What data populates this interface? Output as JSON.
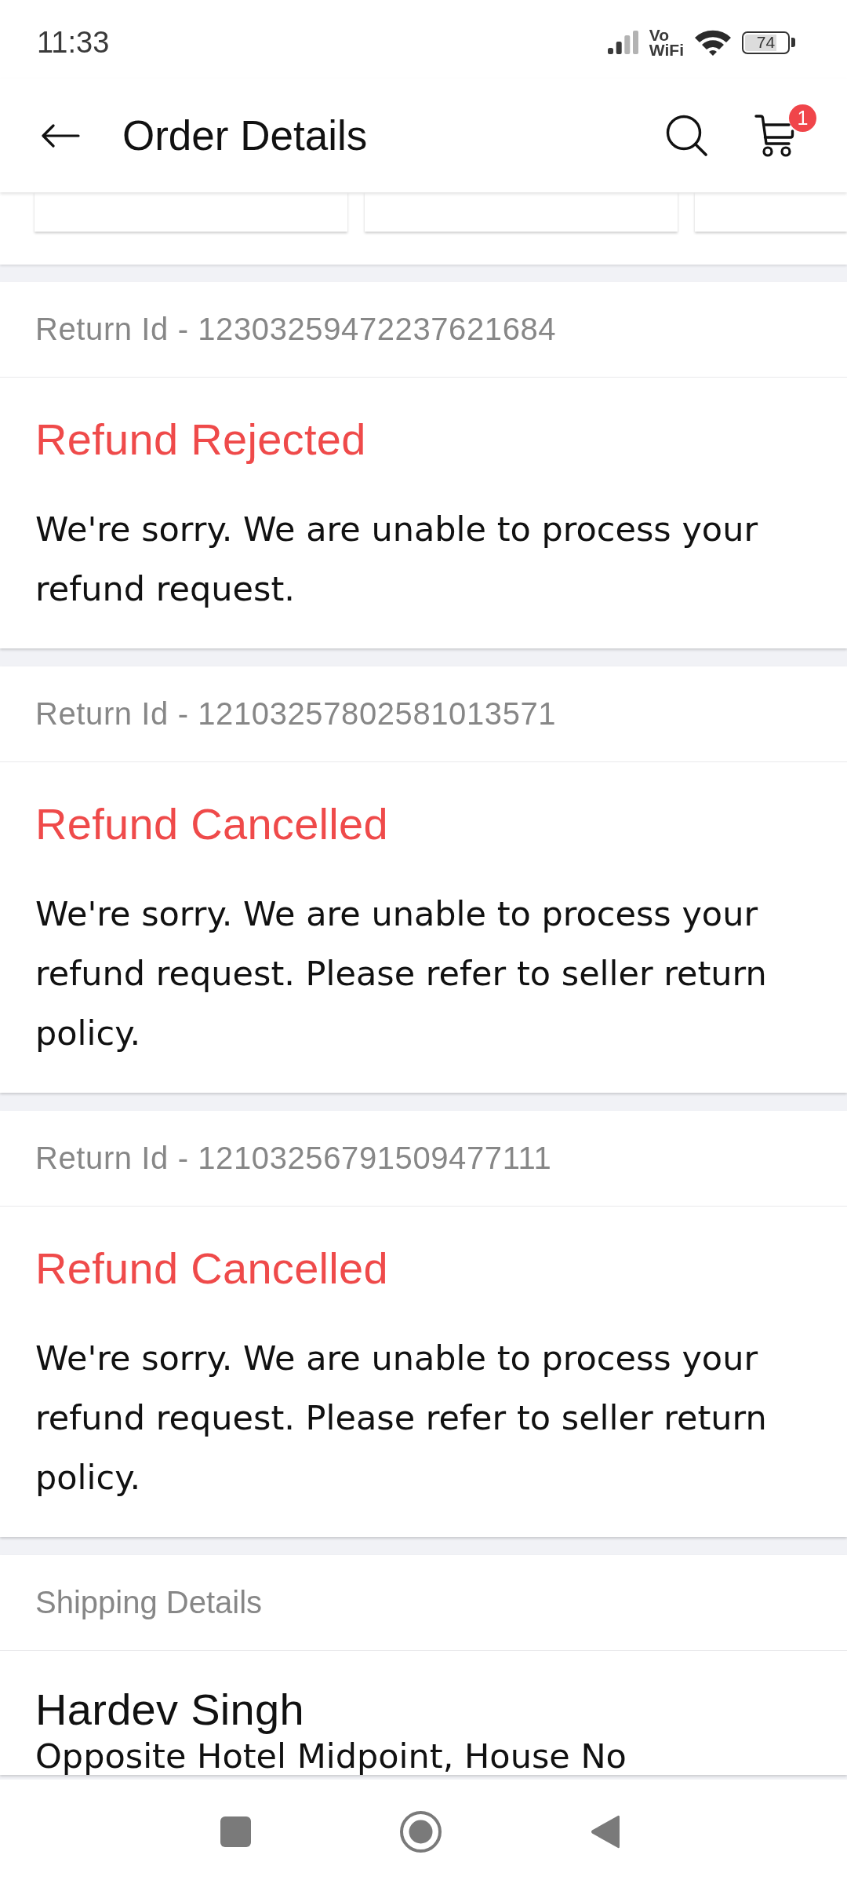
{
  "status_bar": {
    "time": "11:33",
    "network_top": "Vo",
    "network_bottom": "WiFi",
    "battery": "74"
  },
  "app_bar": {
    "title": "Order Details",
    "cart_badge": "1"
  },
  "returns": [
    {
      "return_id": "Return Id - 12303259472237621684",
      "status": "Refund Rejected",
      "message": "We're sorry. We are unable to process your refund request."
    },
    {
      "return_id": "Return Id - 12103257802581013571",
      "status": "Refund Cancelled",
      "message": "We're sorry. We are unable to process your refund request. Please refer to seller return policy."
    },
    {
      "return_id": "Return Id - 12103256791509477111",
      "status": "Refund Cancelled",
      "message": "We're sorry. We are unable to process your refund request. Please refer to seller return policy."
    }
  ],
  "shipping": {
    "heading": "Shipping Details",
    "name": "Hardev Singh",
    "address": "Opposite Hotel Midpoint, House No"
  }
}
